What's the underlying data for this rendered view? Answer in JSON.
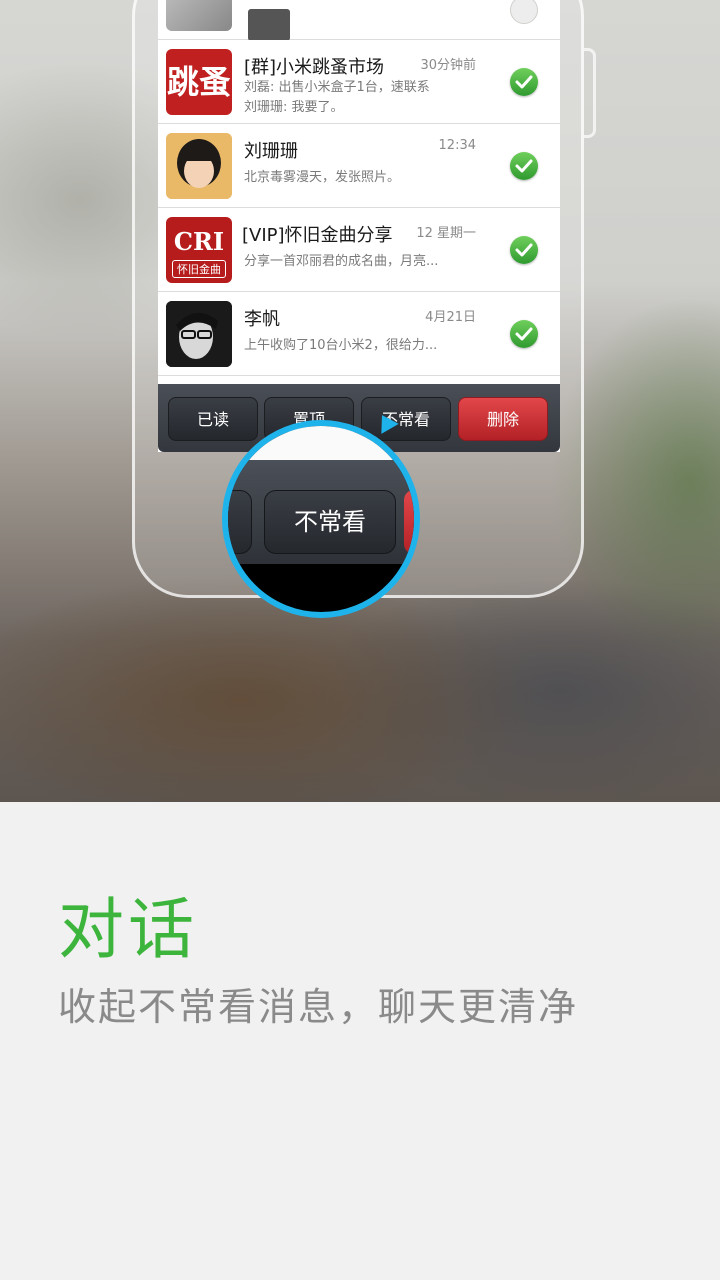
{
  "conversations": [
    {
      "name": "",
      "time": "",
      "preview_line1": "",
      "preview_line2": "",
      "checked": false,
      "avatar": "photo-avatar"
    },
    {
      "name": "[群]小米跳蚤市场",
      "time": "30分钟前",
      "preview_line1": "刘磊: 出售小米盒子1台，速联系",
      "preview_line2": "刘珊珊: 我要了。",
      "checked": true,
      "avatar": "跳蚤"
    },
    {
      "name": "刘珊珊",
      "time": "12:34",
      "preview_line1": "北京毒雾漫天，发张照片。",
      "preview_line2": "",
      "checked": true,
      "avatar": "photo-avatar"
    },
    {
      "name": "[VIP]怀旧金曲分享",
      "time": "12 星期一",
      "preview_line1": "分享一首邓丽君的成名曲，月亮...",
      "preview_line2": "",
      "checked": true,
      "avatar_top": "CRI",
      "avatar_bottom": "怀旧金曲"
    },
    {
      "name": "李帆",
      "time": "4月21日",
      "preview_line1": "上午收购了10台小米2，很给力...",
      "preview_line2": "",
      "checked": true,
      "avatar": "photo-avatar"
    }
  ],
  "toolbar": {
    "read_label": "已读",
    "pin_label": "置顶",
    "infrequent_label": "不常看",
    "delete_label": "删除"
  },
  "magnifier": {
    "label": "不常看"
  },
  "feature": {
    "title": "对话",
    "subtitle": "收起不常看消息，聊天更清净"
  },
  "colors": {
    "accent_green": "#3db53d",
    "highlight_blue": "#1fb3ec",
    "delete_red": "#d23439",
    "check_green": "#3aa63a"
  }
}
